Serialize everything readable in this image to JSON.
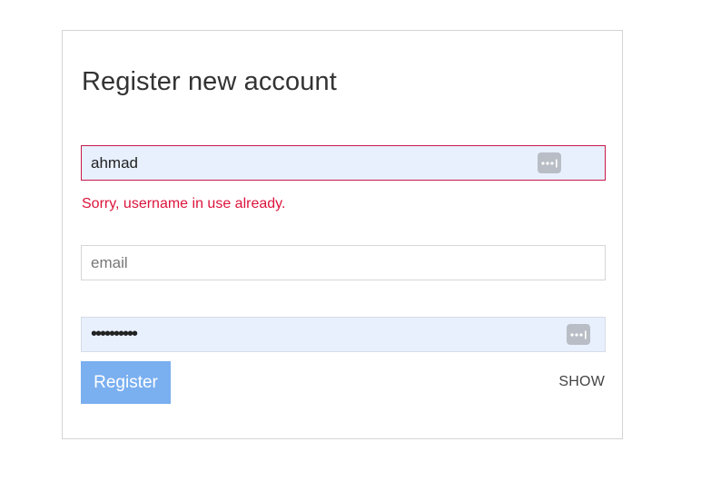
{
  "form": {
    "title": "Register new account",
    "username": {
      "value": "ahmad",
      "error": "Sorry, username in use already.",
      "icon": "password-manager-key-icon"
    },
    "email": {
      "value": "",
      "placeholder": "email"
    },
    "password": {
      "value": "••••••••••",
      "icon": "password-manager-key-icon"
    },
    "register_label": "Register",
    "show_label": "SHOW"
  },
  "colors": {
    "error": "#dc143c",
    "button": "#7aaff0",
    "autofill_bg": "#e8f0fe",
    "border": "#d6d6d6"
  }
}
